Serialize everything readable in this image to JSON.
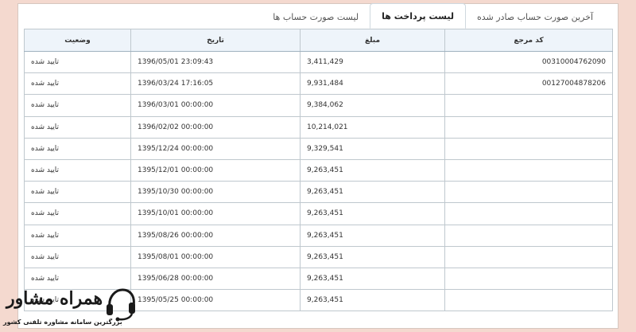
{
  "tabs": [
    {
      "label": "آخرین صورت حساب صادر شده",
      "active": false
    },
    {
      "label": "لیست پرداخت ها",
      "active": true
    },
    {
      "label": "لیست صورت حساب ها",
      "active": false
    }
  ],
  "table": {
    "headers": {
      "ref": "کد مرجع",
      "amount": "مبلغ",
      "date": "تاریخ",
      "status": "وضعیت"
    },
    "rows": [
      {
        "ref": "00310004762090",
        "amount": "3,411,429",
        "date": "1396/05/01  23:09:43",
        "status": "تایید شده"
      },
      {
        "ref": "00127004878206",
        "amount": "9,931,484",
        "date": "1396/03/24  17:16:05",
        "status": "تایید شده"
      },
      {
        "ref": "",
        "amount": "9,384,062",
        "date": "1396/03/01  00:00:00",
        "status": "تایید شده"
      },
      {
        "ref": "",
        "amount": "10,214,021",
        "date": "1396/02/02  00:00:00",
        "status": "تایید شده"
      },
      {
        "ref": "",
        "amount": "9,329,541",
        "date": "1395/12/24  00:00:00",
        "status": "تایید شده"
      },
      {
        "ref": "",
        "amount": "9,263,451",
        "date": "1395/12/01  00:00:00",
        "status": "تایید شده"
      },
      {
        "ref": "",
        "amount": "9,263,451",
        "date": "1395/10/30  00:00:00",
        "status": "تایید شده"
      },
      {
        "ref": "",
        "amount": "9,263,451",
        "date": "1395/10/01  00:00:00",
        "status": "تایید شده"
      },
      {
        "ref": "",
        "amount": "9,263,451",
        "date": "1395/08/26  00:00:00",
        "status": "تایید شده"
      },
      {
        "ref": "",
        "amount": "9,263,451",
        "date": "1395/08/01  00:00:00",
        "status": "تایید شده"
      },
      {
        "ref": "",
        "amount": "9,263,451",
        "date": "1395/06/28  00:00:00",
        "status": "تایید شده"
      },
      {
        "ref": "",
        "amount": "9,263,451",
        "date": "1395/05/25  00:00:00",
        "status": "تایید شده"
      }
    ]
  },
  "watermark": {
    "name": "همراه مشاور",
    "tagline": "بزرگترین سامانه مشاوره تلفنی کشور",
    "icon": "headset-icon"
  }
}
